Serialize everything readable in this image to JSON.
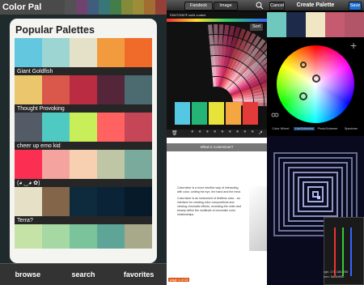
{
  "screen1": {
    "app_title": "Color Pal",
    "section_title": "Popular Palettes",
    "top_stripe": [
      "#5a5a5a",
      "#8e3e8a",
      "#3b6ea8",
      "#2c9a9e",
      "#3ea84a",
      "#b2c02e",
      "#e2c22a",
      "#e88a22",
      "#d0382a"
    ],
    "palettes": [
      {
        "name": "Giant Goldfish",
        "colors": [
          "#63c7df",
          "#9cd5d2",
          "#e5e1c8",
          "#f19a3e",
          "#f06b2a"
        ]
      },
      {
        "name": "Thought Provoking",
        "colors": [
          "#ebc66c",
          "#d9574b",
          "#b92c42",
          "#552639",
          "#4b6b70"
        ]
      },
      {
        "name": "cheer up emo kid",
        "colors": [
          "#535b67",
          "#4fcac2",
          "#c8ef5a",
          "#ff6260",
          "#c54656"
        ]
      },
      {
        "name": "(◕ ‿◕ ✿)",
        "colors": [
          "#fc2f53",
          "#f5a39e",
          "#f7d0b1",
          "#bfc6a6",
          "#7aaa9b"
        ]
      },
      {
        "name": "Terra?",
        "colors": [
          "#e6e0c6",
          "#83664a",
          "#0d2b3d",
          "#0b2337",
          "#061a2a"
        ]
      }
    ],
    "partial_palette": [
      "#c5e3a6",
      "#a6d8a3",
      "#7bc39a",
      "#5fa597",
      "#a8a88b"
    ],
    "nav": {
      "browse": "browse",
      "search": "search",
      "favorites": "favorites"
    }
  },
  "screen2": {
    "tab_fandeck": "Fandeck",
    "tab_image": "Image",
    "subtitle": "PANTONE® solid coated",
    "sort_label": "Sort",
    "swatches": [
      "#54c7e2",
      "#24b576",
      "#e7e33a",
      "#f4a640",
      "#e33a3a"
    ],
    "doc_title": "What is Colorminer?",
    "doc_paragraphs": [
      "Colorminer is a more intuitive way of interacting with color, uniting the eye, the hand and the mind.",
      "Colorminer is an instrument of limitless color - an interface for creating color compositions and viewing chromatic effects, revealing the order and beauty within the multitude of chromatic color relationships."
    ],
    "page_indicator": "page 1 of 15"
  },
  "screen3": {
    "cancel_label": "Cancel",
    "title": "Create Palette",
    "save_label": "Save",
    "palette_row": [
      "#6ec8bd",
      "#1d2a4a",
      "#f1e6c4",
      "#c55a70",
      "#b35568"
    ],
    "add_symbol": "+",
    "modes": [
      "Color Wheel",
      "LiveSchemes",
      "PhotoSchemer",
      "Spectrum"
    ],
    "readout": "rgb: 171 186 255",
    "hex": "hex: 5a/4bf0f0"
  }
}
